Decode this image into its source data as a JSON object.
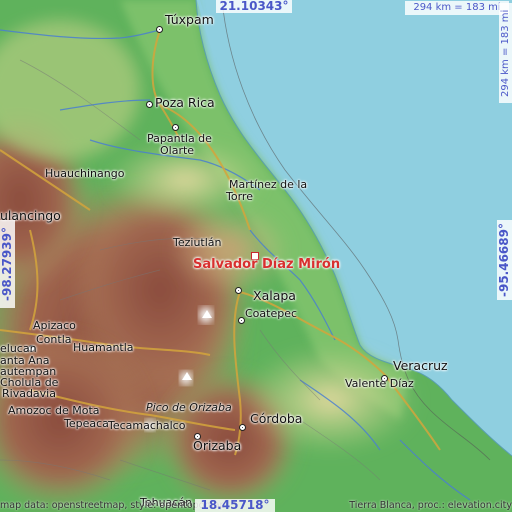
{
  "map": {
    "target": "Salvador Díaz Mirón",
    "lat_top": "21.10343°",
    "lat_bottom": "18.45718°",
    "lon_left": "-98.27939°",
    "lon_right": "-95.46689°",
    "scale_horizontal": "294 km = 183 mi",
    "scale_vertical": "294 km = 183 mi",
    "attribution_left": "map data: openstreetmap, style: opentopomap",
    "attribution_right": "Tierra Blanca, proc.: elevation.city"
  },
  "places": [
    {
      "name": "Túxpam"
    },
    {
      "name": "Poza Rica"
    },
    {
      "name": "Papantla de"
    },
    {
      "name": "Olarte"
    },
    {
      "name": "Huauchinango"
    },
    {
      "name": "Martínez de la"
    },
    {
      "name": "Torre"
    },
    {
      "name": "ulancingo"
    },
    {
      "name": "Teziutlán"
    },
    {
      "name": "Xalapa"
    },
    {
      "name": "Coatepec"
    },
    {
      "name": "Apizaco"
    },
    {
      "name": "Contla"
    },
    {
      "name": "Huamantla"
    },
    {
      "name": "Veracruz"
    },
    {
      "name": "Valente Díaz"
    },
    {
      "name": "elucan"
    },
    {
      "name": "anta Ana"
    },
    {
      "name": "autempan"
    },
    {
      "name": "Cholula de"
    },
    {
      "name": "Rivadavia"
    },
    {
      "name": "Amozoc de Mota"
    },
    {
      "name": "Tepeaca"
    },
    {
      "name": "Tecamachalco"
    },
    {
      "name": "Pico de Orizaba"
    },
    {
      "name": "Córdoba"
    },
    {
      "name": "Orizaba"
    },
    {
      "name": "Tehuacán"
    }
  ]
}
